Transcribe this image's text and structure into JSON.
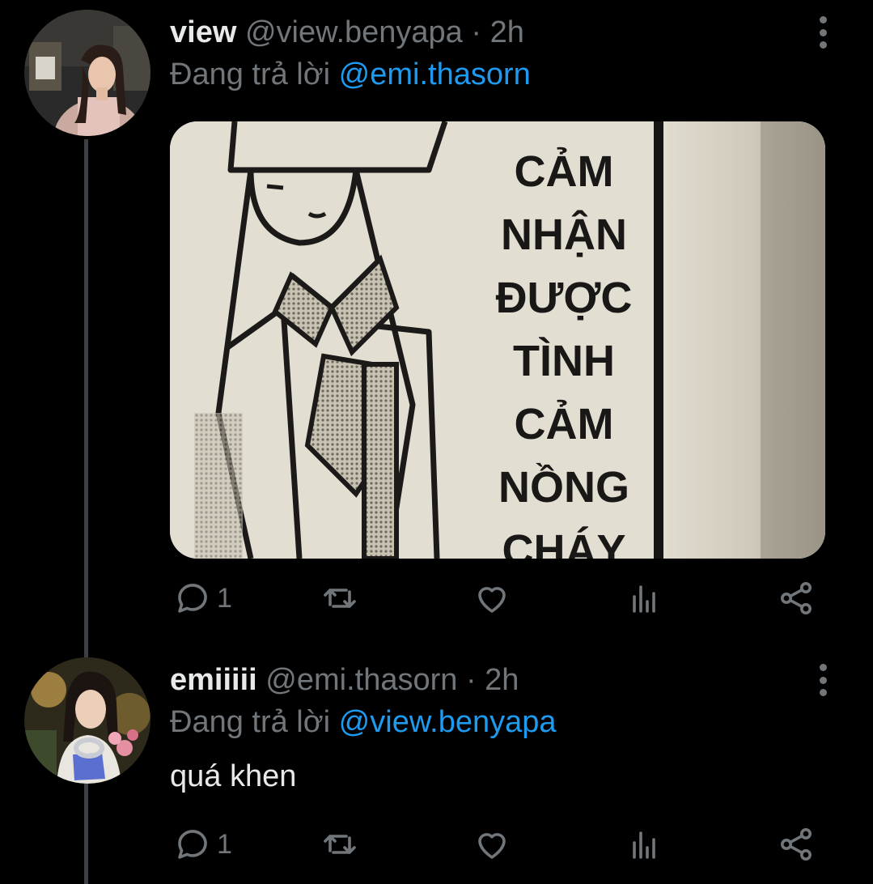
{
  "tweets": [
    {
      "name": "view",
      "handle": "@view.benyapa · 2h",
      "reply_prefix": "Đang trả lời ",
      "reply_to": "@emi.thasorn",
      "media_text": [
        "CẢM",
        "NHẬN",
        "ĐƯỢC",
        "TÌNH",
        "CẢM",
        "NỒNG",
        "CHÁY"
      ],
      "actions": {
        "reply_count": "1",
        "retweet_count": "",
        "like_count": ""
      }
    },
    {
      "name": "emiiiii",
      "handle": "@emi.thasorn · 2h",
      "reply_prefix": "Đang trả lời ",
      "reply_to": "@view.benyapa",
      "text": "quá khen",
      "actions": {
        "reply_count": "1",
        "retweet_count": "",
        "like_count": ""
      }
    }
  ],
  "colors": {
    "background": "#000000",
    "muted": "#71767b",
    "link": "#1d9bf0",
    "text": "#e7e9ea"
  }
}
